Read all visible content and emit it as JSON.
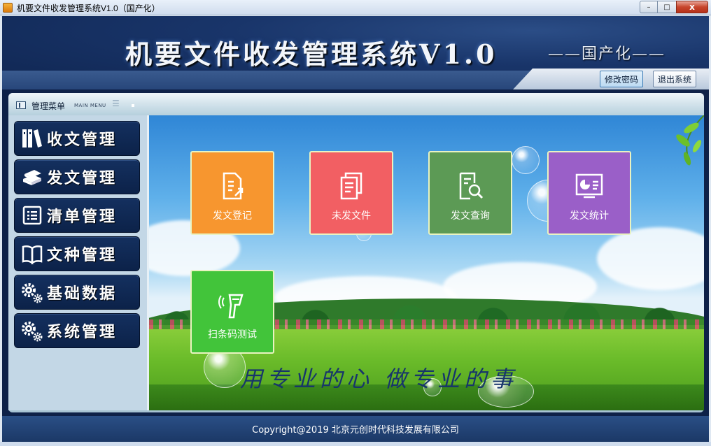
{
  "window": {
    "title": "机要文件收发管理系统V1.0（国产化）",
    "controls": {
      "minimize": "–",
      "maximize": "□",
      "close": "x"
    }
  },
  "header": {
    "title": "机要文件收发管理系统V1.0",
    "subtitle": "——国产化——",
    "change_password_label": "修改密码",
    "exit_label": "退出系统"
  },
  "menu": {
    "title": "管理菜单",
    "title_en": "MAIN MENU",
    "items": [
      {
        "label": "收文管理",
        "icon": "books-icon"
      },
      {
        "label": "发文管理",
        "icon": "stack-books-icon"
      },
      {
        "label": "清单管理",
        "icon": "list-icon"
      },
      {
        "label": "文种管理",
        "icon": "open-book-icon"
      },
      {
        "label": "基础数据",
        "icon": "gears-icon"
      },
      {
        "label": "系统管理",
        "icon": "gears-icon"
      }
    ]
  },
  "tiles": [
    {
      "label": "发文登记",
      "color": "#f7962f",
      "icon": "document-export-icon"
    },
    {
      "label": "未发文件",
      "color": "#f25f63",
      "icon": "documents-stack-icon"
    },
    {
      "label": "发文查询",
      "color": "#5c9a55",
      "icon": "document-search-icon"
    },
    {
      "label": "发文统计",
      "color": "#9a5fc8",
      "icon": "chart-window-icon"
    },
    {
      "label": "扫条码测试",
      "color": "#42c43a",
      "icon": "barcode-scanner-icon"
    }
  ],
  "slogan": "用专业的心 做专业的事",
  "footer": {
    "copyright": "Copyright@2019 北京元创时代科技发展有限公司"
  },
  "colors": {
    "navy": "#0e2148",
    "tile_border": "#e9f3c1"
  }
}
